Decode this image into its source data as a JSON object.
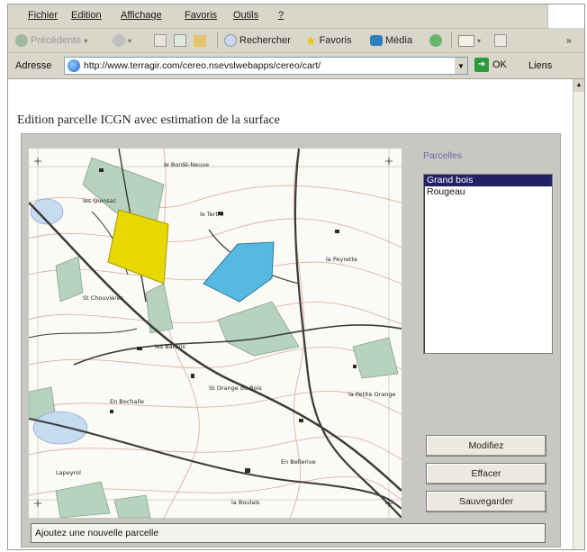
{
  "menu": [
    "Fichier",
    "Edition",
    "Affichage",
    "Favoris",
    "Outils",
    "?"
  ],
  "toolbar": {
    "back_label": "Précédente",
    "search_label": "Rechercher",
    "favorites_label": "Favoris",
    "media_label": "Média"
  },
  "address": {
    "label": "Adresse",
    "url": "http://www.terragir.com/cereo.nsevslwebapps/cereo/cart/",
    "go_label": "OK",
    "links_label": "Liens"
  },
  "page": {
    "title": "Edition parcelle ICGN avec estimation de la surface"
  },
  "parcelles": {
    "label": "Parcelles",
    "items": [
      "Grand bois",
      "Rougeau"
    ],
    "selected": "Grand bois"
  },
  "buttons": {
    "modifier": "Modifiez",
    "effacer": "Effacer",
    "sauvegarder": "Sauvegarder"
  },
  "status": {
    "text": "Ajoutez une nouvelle parcelle"
  },
  "map": {
    "place_names": [
      "le Bordé-Neuve",
      "le Tertre",
      "la Peyrette",
      "les Quinsac",
      "St Chouvières",
      "les Barons",
      "St Orange du Bois",
      "la Petite Orange",
      "En Bochalle",
      "Lapeyrol",
      "En Bellerive",
      "la Boulais"
    ],
    "parcel_colors": {
      "grand_bois": "#e6d800",
      "rougeau": "#58b9e0",
      "forest": "#b7d2be"
    }
  }
}
